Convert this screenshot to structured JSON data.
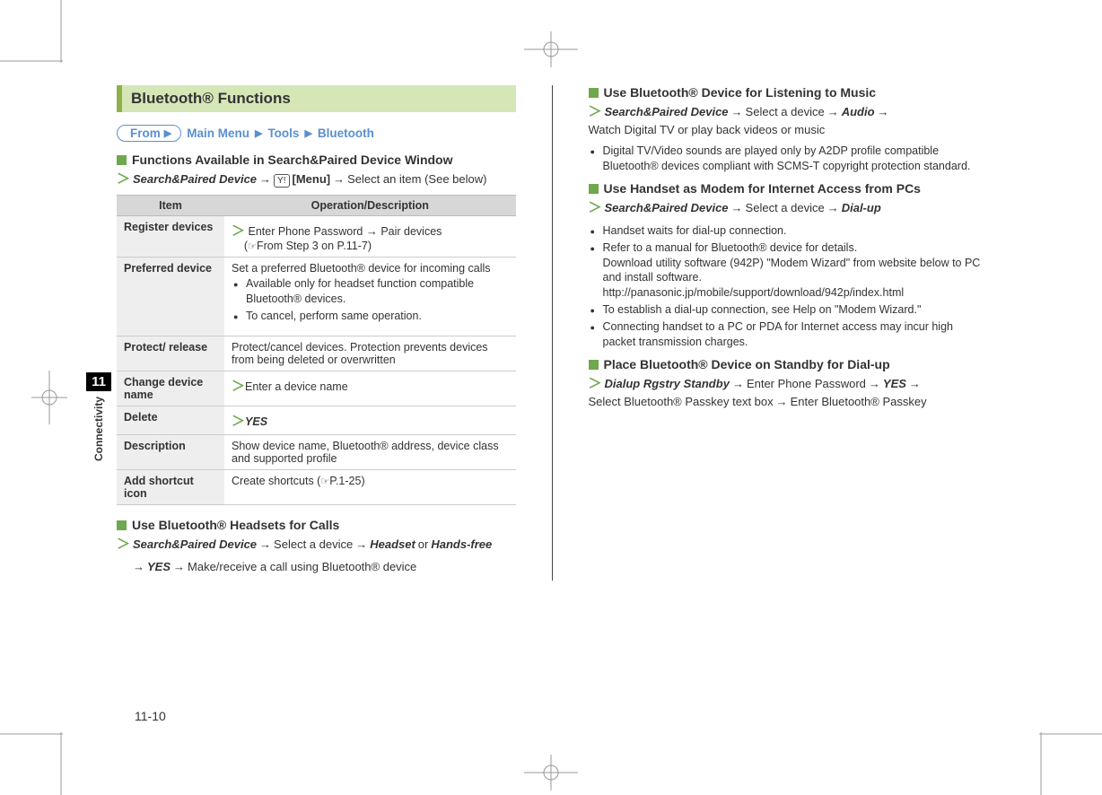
{
  "section_title": "Bluetooth® Functions",
  "breadcrumb": {
    "from": "From",
    "main_menu": "Main Menu",
    "tools": "Tools",
    "bluetooth": "Bluetooth"
  },
  "left": {
    "h1": "Functions Available in Search&Paired Device Window",
    "path1": {
      "a": "Search&Paired Device",
      "menu": "[Menu]",
      "tail": "Select an item (See below)"
    },
    "table_headers": {
      "item": "Item",
      "desc": "Operation/Description"
    },
    "rows": [
      {
        "name": "Register devices",
        "chev": "Enter Phone Password",
        "arrow_tail": "Pair devices",
        "paren": "From Step 3 on P.11-7"
      },
      {
        "name": "Preferred device",
        "lead": "Set a preferred Bluetooth® device for incoming calls",
        "b1": "Available only for headset function compatible Bluetooth® devices.",
        "b2": "To cancel, perform same operation."
      },
      {
        "name": "Protect/ release",
        "text": "Protect/cancel devices. Protection prevents devices from being deleted or overwritten"
      },
      {
        "name": "Change device name",
        "chev": "Enter a device name"
      },
      {
        "name": "Delete",
        "yes": "YES"
      },
      {
        "name": "Description",
        "text": "Show device name, Bluetooth® address, device class and supported profile"
      },
      {
        "name": "Add shortcut icon",
        "text_pre": "Create shortcuts (",
        "text_ref": "P.1-25",
        "text_post": ")"
      }
    ],
    "h2": "Use Bluetooth® Headsets for Calls",
    "path2": {
      "a": "Search&Paired Device",
      "b": "Select a device",
      "c": "Headset",
      "or": "or",
      "d": "Hands-free",
      "e": "YES",
      "f": "Make/receive a call using Bluetooth® device"
    }
  },
  "right": {
    "h1": "Use Bluetooth® Device for Listening to Music",
    "path1": {
      "a": "Search&Paired Device",
      "b": "Select a device",
      "c": "Audio",
      "d": "Watch Digital TV or play back videos or music"
    },
    "b1": "Digital TV/Video sounds are played only by A2DP profile compatible Bluetooth® devices compliant with SCMS-T copyright protection standard.",
    "h2": "Use Handset as Modem for Internet Access from PCs",
    "path2": {
      "a": "Search&Paired Device",
      "b": "Select a device",
      "c": "Dial-up"
    },
    "b2": "Handset waits for dial-up connection.",
    "b3a": "Refer to a manual for Bluetooth® device for details.",
    "b3b": "Download utility software (942P) \"Modem Wizard\" from website below to PC and install software.",
    "b3c": "http://panasonic.jp/mobile/support/download/942p/index.html",
    "b4": "To establish a dial-up connection, see Help on \"Modem Wizard.\"",
    "b5": "Connecting handset to a PC or PDA for Internet access may incur high packet transmission charges.",
    "h3": "Place Bluetooth® Device on Standby for Dial-up",
    "path3": {
      "a": "Dialup Rgstry Standby",
      "b": "Enter Phone Password",
      "c": "YES",
      "d": "Select Bluetooth® Passkey text box",
      "e": "Enter Bluetooth® Passkey"
    }
  },
  "side": {
    "num": "11",
    "label": "Connectivity"
  },
  "page_num": "11-10"
}
